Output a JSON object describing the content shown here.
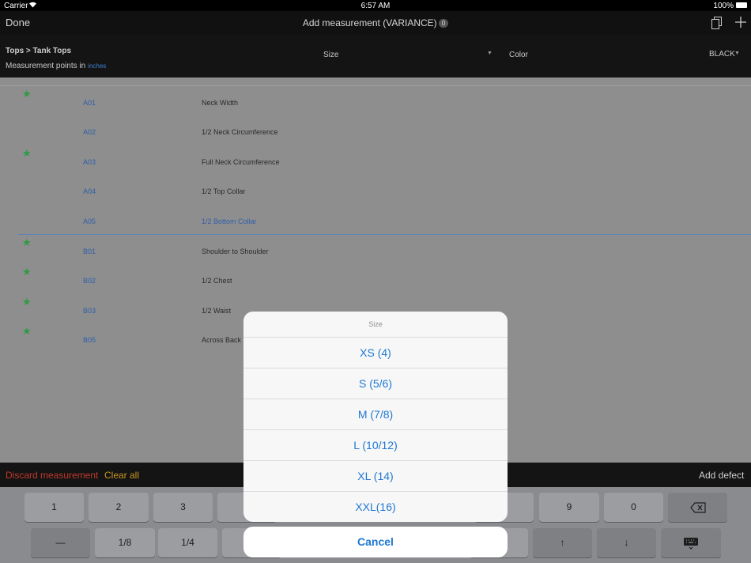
{
  "status_bar": {
    "carrier": "Carrier",
    "time": "6:57 AM",
    "battery": "100%"
  },
  "nav": {
    "done": "Done",
    "title": "Add measurement (VARIANCE)",
    "badge": "0"
  },
  "header": {
    "breadcrumb": "Tops > Tank Tops",
    "measurement_label": "Measurement points in",
    "unit": "inches",
    "size_label": "Size",
    "color_label": "Color",
    "color_value": "BLACK"
  },
  "rows": [
    {
      "code": "A01",
      "desc": "Neck Width",
      "star": "★"
    },
    {
      "code": "A02",
      "desc": "1/2 Neck Circumference",
      "star": ""
    },
    {
      "code": "A03",
      "desc": "Full Neck Circumference",
      "star": "★"
    },
    {
      "code": "A04",
      "desc": "1/2 Top Collar",
      "star": ""
    },
    {
      "code": "A05",
      "desc": "1/2 Bottom Collar",
      "star": ""
    },
    {
      "code": "B01",
      "desc": "Shoulder to Shoulder",
      "star": "★"
    },
    {
      "code": "B02",
      "desc": "1/2 Chest",
      "star": "★"
    },
    {
      "code": "B03",
      "desc": "1/2 Waist",
      "star": "★"
    },
    {
      "code": "B05",
      "desc": "Across Back",
      "star": "★"
    }
  ],
  "actions": {
    "discard": "Discard measurement",
    "clear": "Clear all",
    "add_defect": "Add defect"
  },
  "keyboard": {
    "row1": [
      "1",
      "2",
      "3",
      "9",
      "0"
    ],
    "row2": [
      "—",
      "1/8",
      "1/4",
      "↑",
      "↓"
    ]
  },
  "sheet": {
    "title": "Size",
    "options": [
      "XS (4)",
      "S (5/6)",
      "M (7/8)",
      "L (10/12)",
      "XL (14)",
      "XXL(16)"
    ],
    "cancel": "Cancel"
  }
}
